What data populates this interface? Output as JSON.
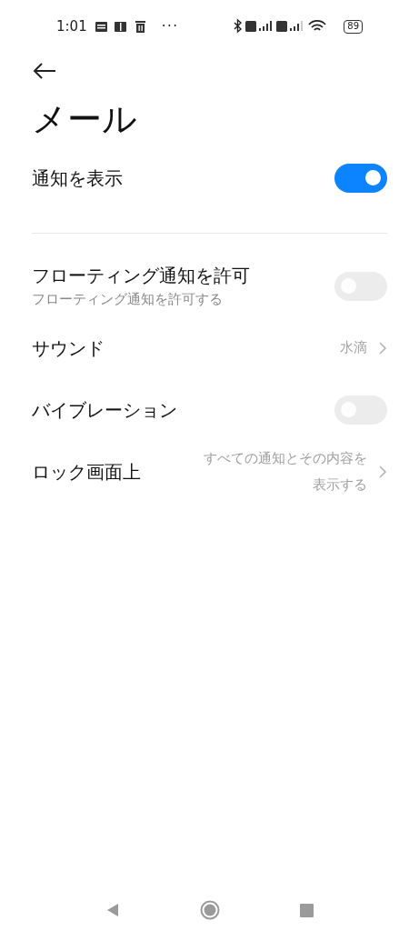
{
  "status_bar": {
    "time": "1:01",
    "more": "···",
    "battery": "89"
  },
  "title": "メール",
  "main_setting": {
    "label": "通知を表示",
    "on": true
  },
  "settings": [
    {
      "kind": "toggle",
      "label": "フローティング通知を許可",
      "subtitle": "フローティング通知を許可する",
      "on": false,
      "disabled": true
    },
    {
      "kind": "link",
      "label": "サウンド",
      "value": "水滴"
    },
    {
      "kind": "toggle",
      "label": "バイブレーション",
      "on": false,
      "disabled": true
    },
    {
      "kind": "link",
      "label": "ロック画面上",
      "value": "すべての通知とその内容を表示する"
    }
  ]
}
